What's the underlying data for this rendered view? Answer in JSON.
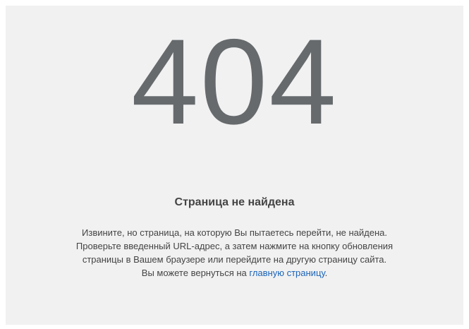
{
  "error": {
    "code": "404",
    "title": "Страница не найдена",
    "description": "Извините, но страница, на которую Вы пытаетесь перейти, не найдена. Проверьте введенный URL-адрес, а затем нажмите на кнопку обновления страницы в Вашем браузере или перейдите на другую страницу сайта.",
    "return_prefix": "Вы можете вернуться на ",
    "home_link_label": "главную страницу",
    "return_suffix": "."
  },
  "colors": {
    "background": "#f1f1f1",
    "code": "#666a6d",
    "text": "#444444",
    "link": "#1a63b8"
  }
}
